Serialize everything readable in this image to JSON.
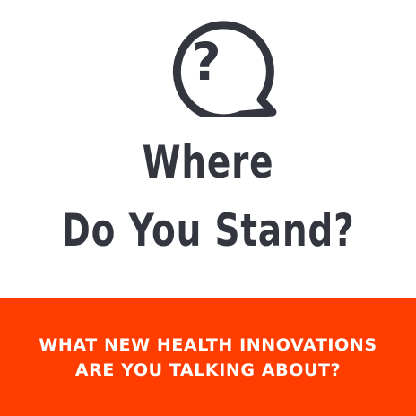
{
  "icons": {
    "speech_bubble": "speech-bubble-question-icon",
    "question_glyph": "?"
  },
  "headline": {
    "line1": "Where",
    "line2": "Do You Stand?"
  },
  "banner": {
    "line1": "WHAT NEW HEALTH INNOVATIONS",
    "line2": "ARE YOU TALKING ABOUT?"
  },
  "colors": {
    "text_dark": "#33363f",
    "banner_bg": "#ff3d00",
    "banner_text": "#ffffff",
    "background": "#ffffff"
  }
}
